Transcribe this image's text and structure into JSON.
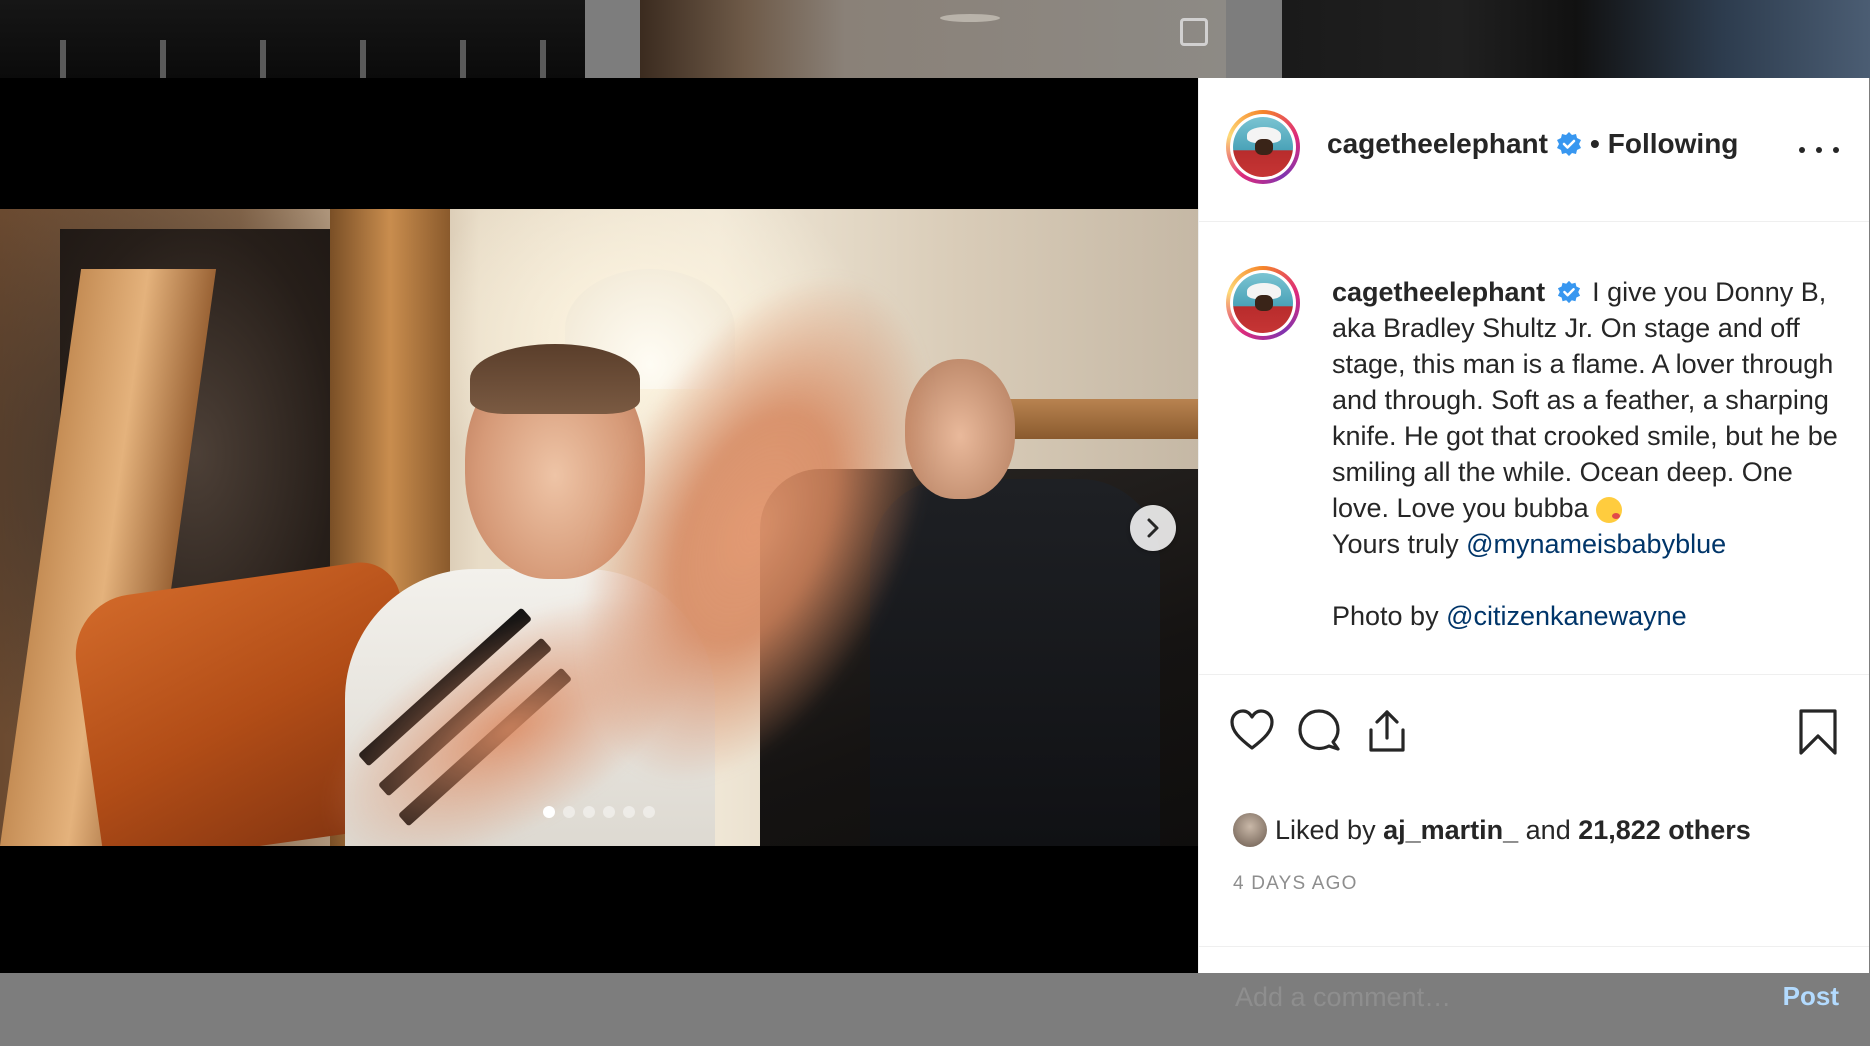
{
  "post": {
    "username": "cagetheelephant",
    "follow_status": "Following",
    "caption_lines": [
      "I give you Donny B, aka Bradley Shultz Jr. On stage and off stage, this man is a flame. A lover through and through. Soft as a feather, a sharping knife. He got that crooked smile, but he be smiling all the while. Ocean deep. One love. Love you bubba"
    ],
    "yours_truly_prefix": "Yours truly ",
    "yours_truly_mention": "@mynameisbabyblue",
    "photo_by_prefix": "Photo by ",
    "photo_by_mention": "@citizenkanewayne",
    "liked_by_prefix": "Liked by ",
    "liked_by_user": "aj_martin_",
    "liked_by_and": " and ",
    "liked_by_others": "21,822 others",
    "timestamp": "4 DAYS AGO",
    "comment_placeholder": "Add a comment…",
    "post_button": "Post"
  },
  "carousel": {
    "slide_count": 6,
    "active_index": 0
  },
  "icons": {
    "verified": "verified-badge-icon",
    "more": "more-options-icon",
    "like": "heart-icon",
    "comment": "comment-icon",
    "share": "share-icon",
    "save": "bookmark-icon",
    "next": "chevron-right-icon"
  },
  "colors": {
    "verified_blue": "#3897f0",
    "link": "#003569",
    "post_disabled": "#b3dbff"
  }
}
